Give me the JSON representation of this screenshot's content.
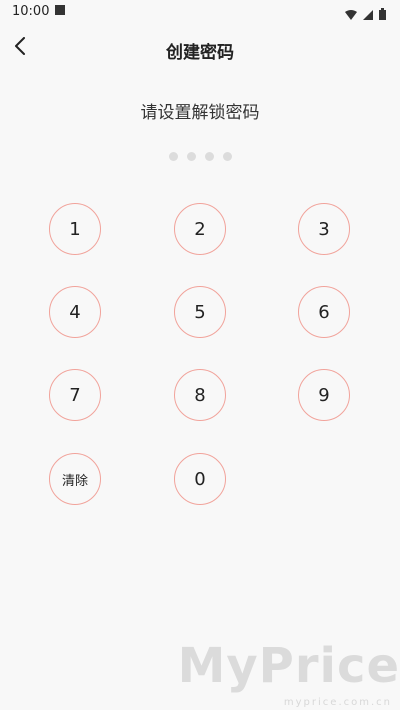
{
  "status_bar": {
    "time": "10:00",
    "icons": [
      "wifi-icon",
      "signal-icon",
      "battery-icon"
    ]
  },
  "header": {
    "back_icon": "chevron-left-icon",
    "title": "创建密码"
  },
  "prompt": "请设置解锁密码",
  "pin_dots_count": 4,
  "keypad": {
    "keys": [
      "1",
      "2",
      "3",
      "4",
      "5",
      "6",
      "7",
      "8",
      "9",
      "清除",
      "0"
    ]
  },
  "watermark": {
    "main": "MyPrice",
    "sub": "myprice.com.cn"
  },
  "colors": {
    "key_border": "#f1a39b",
    "background": "#f8f8f8"
  }
}
